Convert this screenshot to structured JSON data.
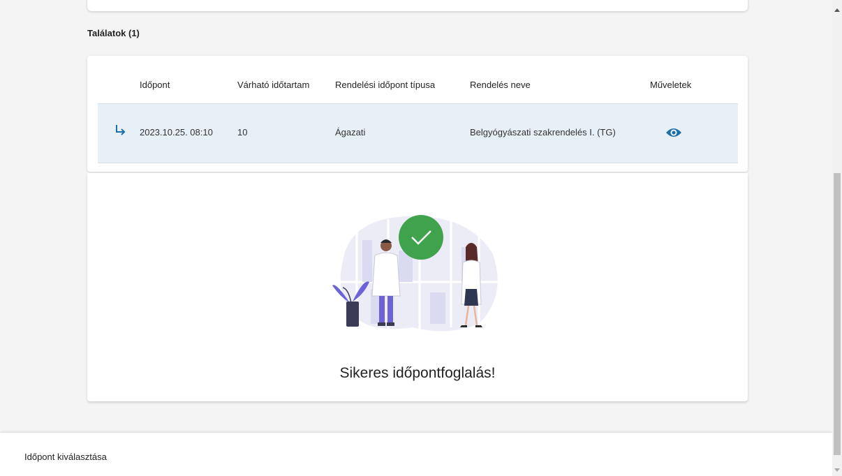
{
  "results": {
    "title": "Találatok (1)",
    "columns": [
      "Időpont",
      "Várható időtartam",
      "Rendelési időpont típusa",
      "Rendelés neve",
      "Műveletek"
    ],
    "rows": [
      {
        "time": "2023.10.25. 08:10",
        "duration": "10",
        "type": "Ágazati",
        "name": "Belgyógyászati szakrendelés I. (TG)",
        "action_icon": "eye-icon"
      }
    ]
  },
  "success": {
    "message": "Sikeres időpontfoglalás!",
    "icon": "check-icon"
  },
  "bottom": {
    "label": "Időpont kiválasztása"
  },
  "colors": {
    "accent": "#1e6fa8",
    "success": "#3fa34d",
    "row_highlight": "#e8f0f7",
    "illustration": "#7b6fd6"
  }
}
